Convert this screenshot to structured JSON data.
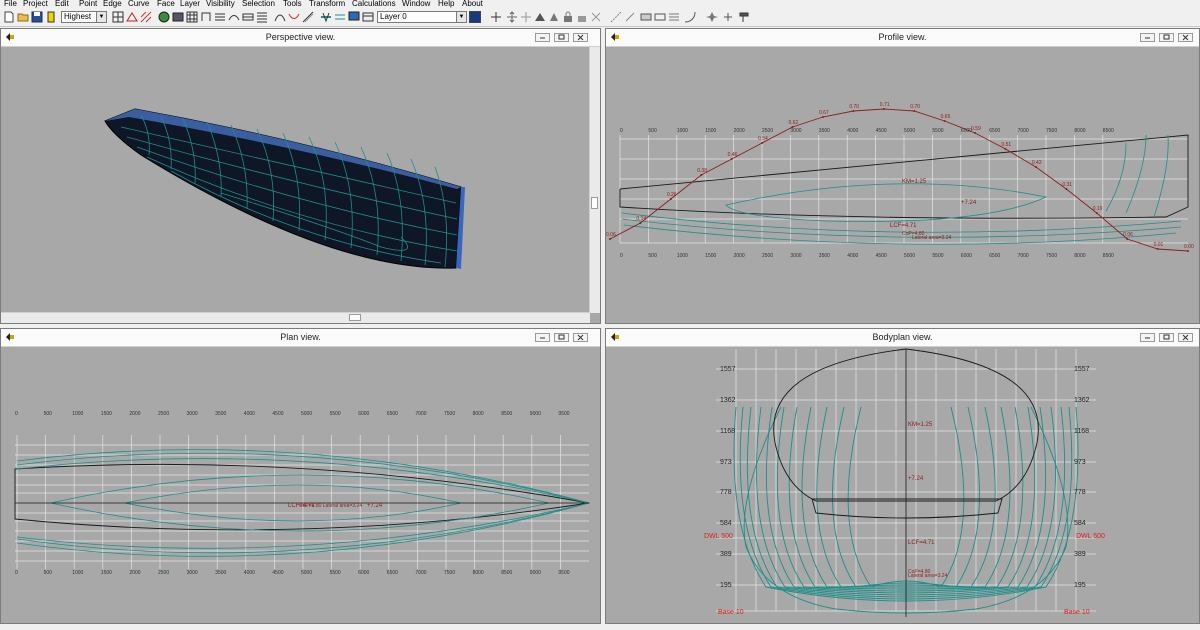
{
  "menu": [
    "File",
    "Project",
    "Edit",
    "Point",
    "Edge",
    "Curve",
    "Face",
    "Layer",
    "Visibility",
    "Selection",
    "Tools",
    "Transform",
    "Calculations",
    "Window",
    "Help",
    "About"
  ],
  "toolbar": {
    "precision_value": "Highest",
    "layer_value": "Layer 0",
    "layer_color": "#173b78"
  },
  "colors": {
    "background": "#a8a8a8",
    "hull": "#0f1626",
    "curves": "#1f8f8a",
    "hydro": "#8a1f1f",
    "stations": "#e8e8e8"
  },
  "panes": {
    "perspective": {
      "title": "Perspective view."
    },
    "profile": {
      "title": "Profile view.",
      "ticks": [
        "0",
        "500",
        "1000",
        "1500",
        "2000",
        "2500",
        "3000",
        "3500",
        "4000",
        "4500",
        "5000",
        "5500",
        "6000",
        "6500",
        "7000",
        "7500",
        "8000",
        "8500"
      ],
      "curve_labels": [
        "0.06",
        "0.14",
        "0.26",
        "0.38",
        "0.46",
        "0.54",
        "0.62",
        "0.67",
        "0.70",
        "0.71",
        "0.70",
        "0.65",
        "0.59",
        "0.51",
        "0.42",
        "0.31",
        "0.19",
        "0.06",
        "0.01",
        "0.00"
      ],
      "hydro_km": "KM=1.25",
      "hydro_t": "+7.24",
      "hydro_lcf": "LCF=4.71",
      "hydro_cp": "CoP=4.80",
      "hydro_lat": "Lateral area=3.24"
    },
    "plan": {
      "title": "Plan view.",
      "ticks": [
        "0",
        "500",
        "1000",
        "1500",
        "2000",
        "2500",
        "3000",
        "3500",
        "4000",
        "4500",
        "5000",
        "5500",
        "6000",
        "6500",
        "7000",
        "7500",
        "8000",
        "8500",
        "9000",
        "9500"
      ],
      "hydro_lcf": "LCF=4.71",
      "hydro_lat": "CoP=4.80 Lateral area=3.24",
      "hydro_t": "+7.24"
    },
    "bodyplan": {
      "title": "Bodyplan view.",
      "heights": [
        "1557",
        "1362",
        "1168",
        "973",
        "778",
        "584",
        "389",
        "195"
      ],
      "dwl": "DWL 500",
      "base": "Base 10",
      "hydro_km": "KM=1.25",
      "hydro_t": "+7.24",
      "hydro_lcf": "LCF=4.71",
      "hydro_cp": "CoP=4.80",
      "hydro_lat": "Lateral area=3.24"
    }
  }
}
